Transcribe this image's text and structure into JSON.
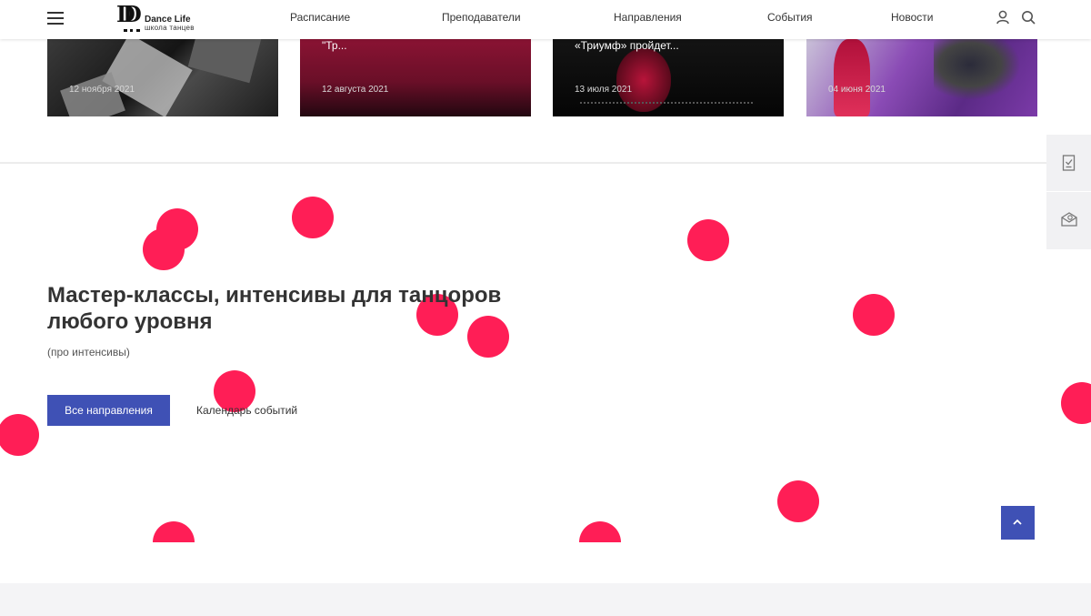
{
  "header": {
    "logo": {
      "name": "Dance Life",
      "subtitle": "школа танцев",
      "mark": "D"
    },
    "nav": [
      {
        "label": "Расписание"
      },
      {
        "label": "Преподаватели"
      },
      {
        "label": "Направления"
      },
      {
        "label": "События"
      },
      {
        "label": "Новости"
      }
    ],
    "icons": [
      "menu-icon",
      "user-icon",
      "search-icon"
    ]
  },
  "news_cards": [
    {
      "title": "",
      "date": "12 ноября 2021"
    },
    {
      "title": "\"Тр...",
      "date": "12 августа 2021"
    },
    {
      "title": "«Триумф» пройдет...",
      "date": "13 июля 2021"
    },
    {
      "title": "",
      "date": "04 июня 2021"
    }
  ],
  "side_widget": {
    "icons": [
      "checklist-icon",
      "mail-icon"
    ]
  },
  "hero": {
    "title": "Мастер-классы, интенсивы для танцоров любого уровня",
    "subtitle": "(про интенсивы)",
    "primary_button": "Все направления",
    "secondary_link": "Календарь событий"
  },
  "colors": {
    "accent": "#3f51b5",
    "dot": "#ff1e56",
    "text": "#333333"
  },
  "scroll_top_icon": "chevron-up-icon"
}
